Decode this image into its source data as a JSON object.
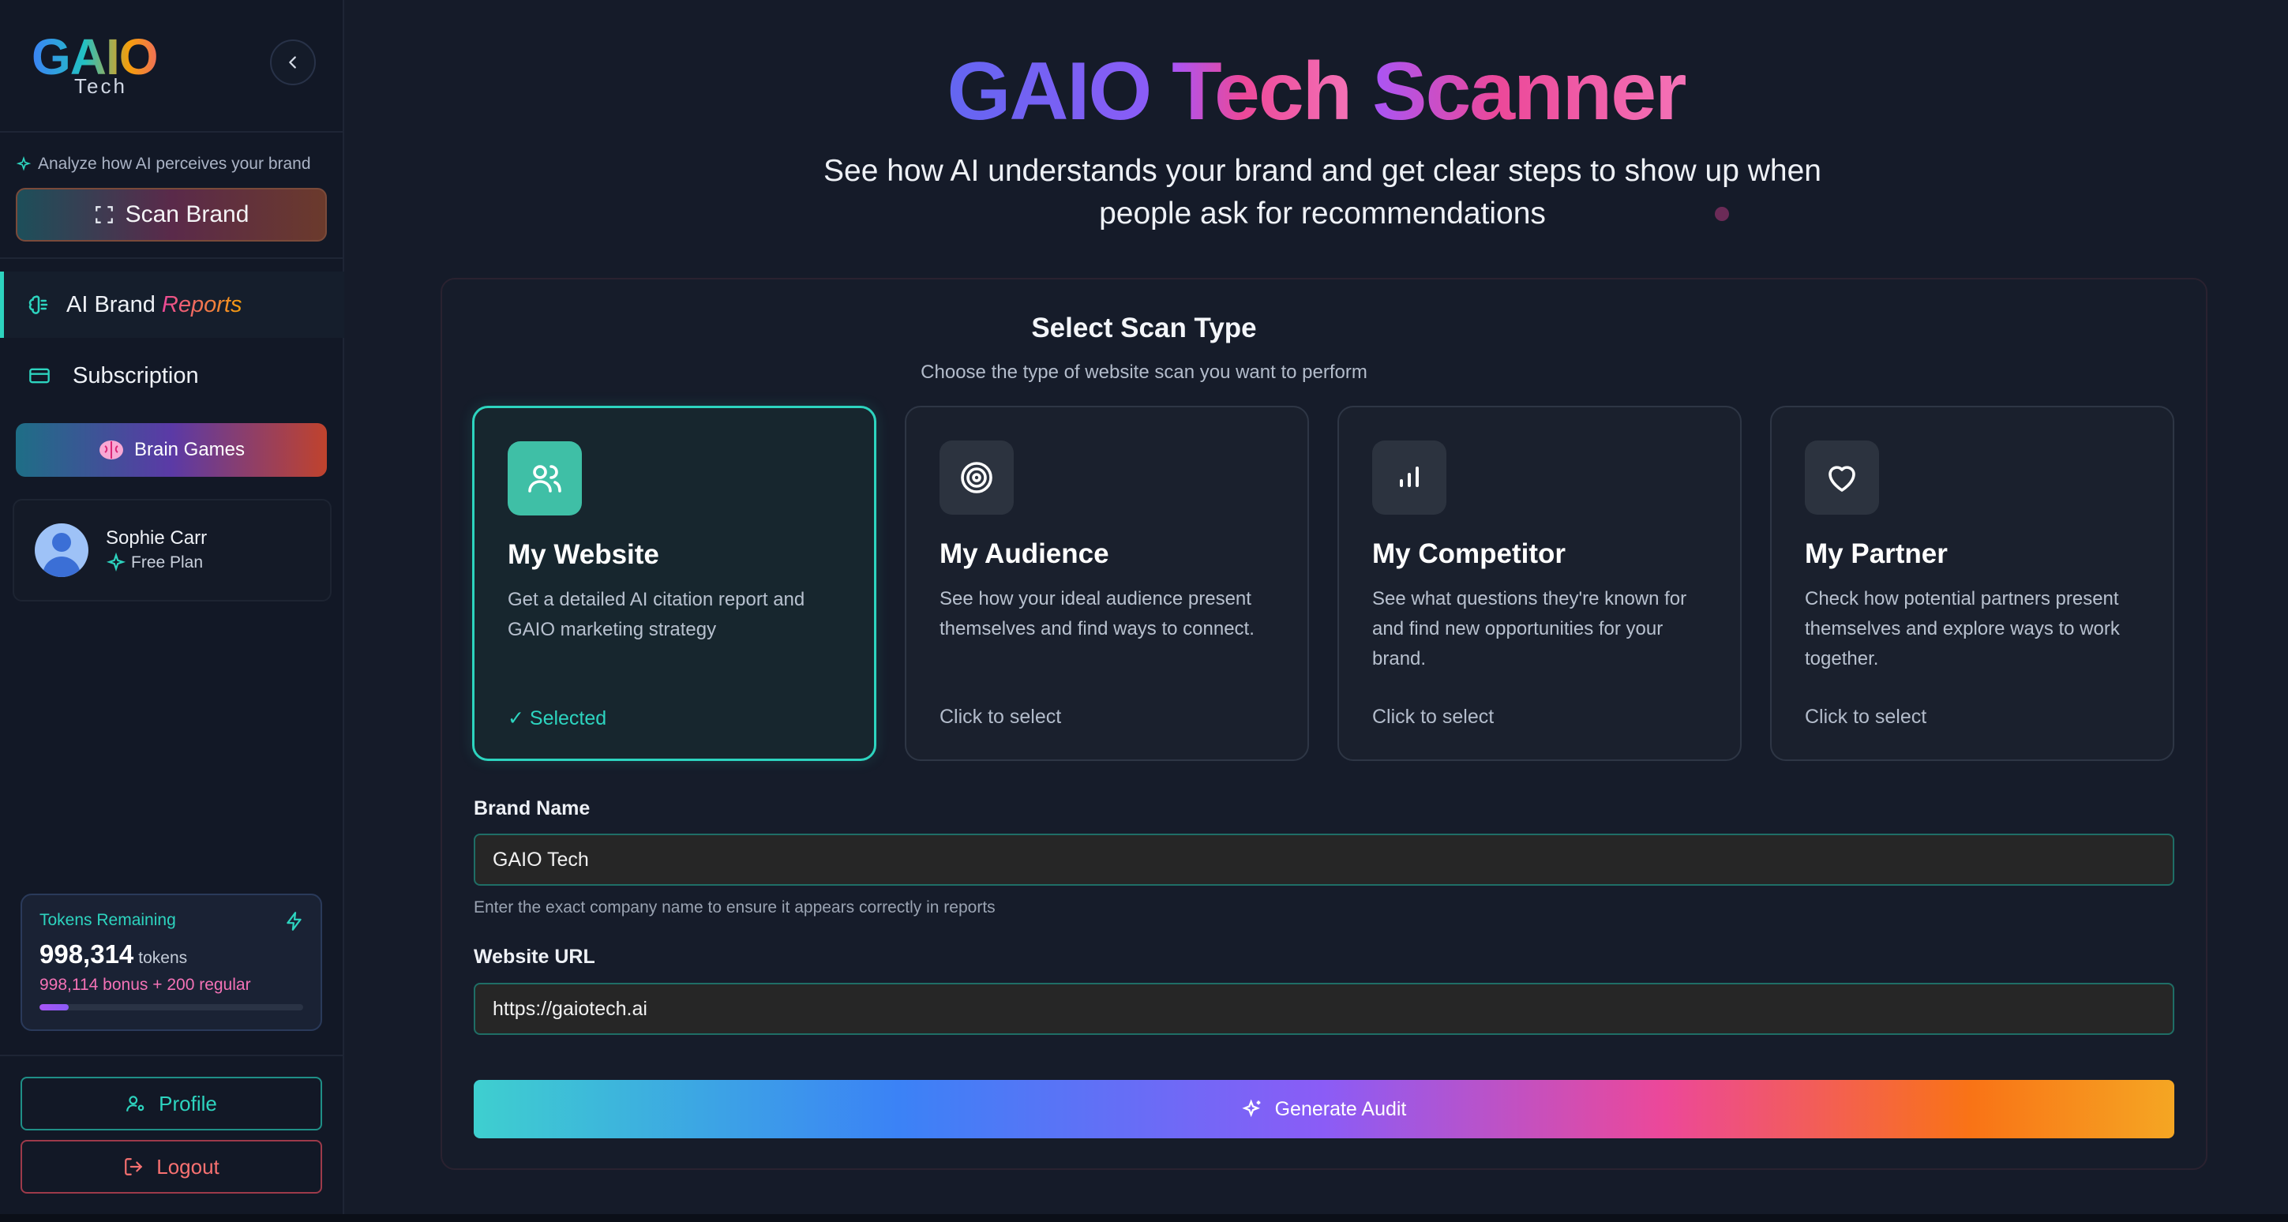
{
  "brand": {
    "logo_main": "GAIO",
    "logo_sub": "Tech"
  },
  "sidebar": {
    "tagline": "Analyze how AI perceives your brand",
    "scan_button": "Scan Brand",
    "nav": [
      {
        "label_main": "AI Brand",
        "label_accent": "Reports",
        "active": true
      },
      {
        "label_main": "Subscription",
        "active": false
      }
    ],
    "brain_games": "Brain Games",
    "user": {
      "name": "Sophie Carr",
      "plan": "Free Plan"
    },
    "tokens": {
      "title": "Tokens Remaining",
      "count": "998,314",
      "unit": "tokens",
      "breakdown": "998,114 bonus + 200 regular",
      "fill_fraction": 0.11
    },
    "profile_button": "Profile",
    "logout_button": "Logout"
  },
  "main": {
    "title_part1": "GAIO",
    "title_part2": "Tech",
    "title_part3": "Scanner",
    "subtitle": "See how AI understands your brand and get clear steps to show up when people ask for recommendations",
    "panel": {
      "title": "Select Scan Type",
      "subtitle": "Choose the type of website scan you want to perform",
      "cards": [
        {
          "icon": "users-icon",
          "title": "My Website",
          "desc": "Get a detailed AI citation report and GAIO marketing strategy",
          "status": "✓ Selected",
          "selected": true
        },
        {
          "icon": "target-icon",
          "title": "My Audience",
          "desc": "See how your ideal audience present themselves and find ways to connect.",
          "status": "Click to select",
          "selected": false
        },
        {
          "icon": "bar-chart-icon",
          "title": "My Competitor",
          "desc": "See what questions they're known for and find new opportunities for your brand.",
          "status": "Click to select",
          "selected": false
        },
        {
          "icon": "heart-icon",
          "title": "My Partner",
          "desc": "Check how potential partners present themselves and explore ways to work together.",
          "status": "Click to select",
          "selected": false
        }
      ],
      "brand_name": {
        "label": "Brand Name",
        "value": "GAIO Tech",
        "hint": "Enter the exact company name to ensure it appears correctly in reports"
      },
      "website_url": {
        "label": "Website URL",
        "value": "https://gaiotech.ai"
      },
      "generate_button": "Generate Audit"
    }
  },
  "colors": {
    "accent_teal": "#2dd4bf",
    "accent_pink": "#ec4899",
    "accent_purple": "#8b5cf6",
    "background": "#151b29"
  }
}
